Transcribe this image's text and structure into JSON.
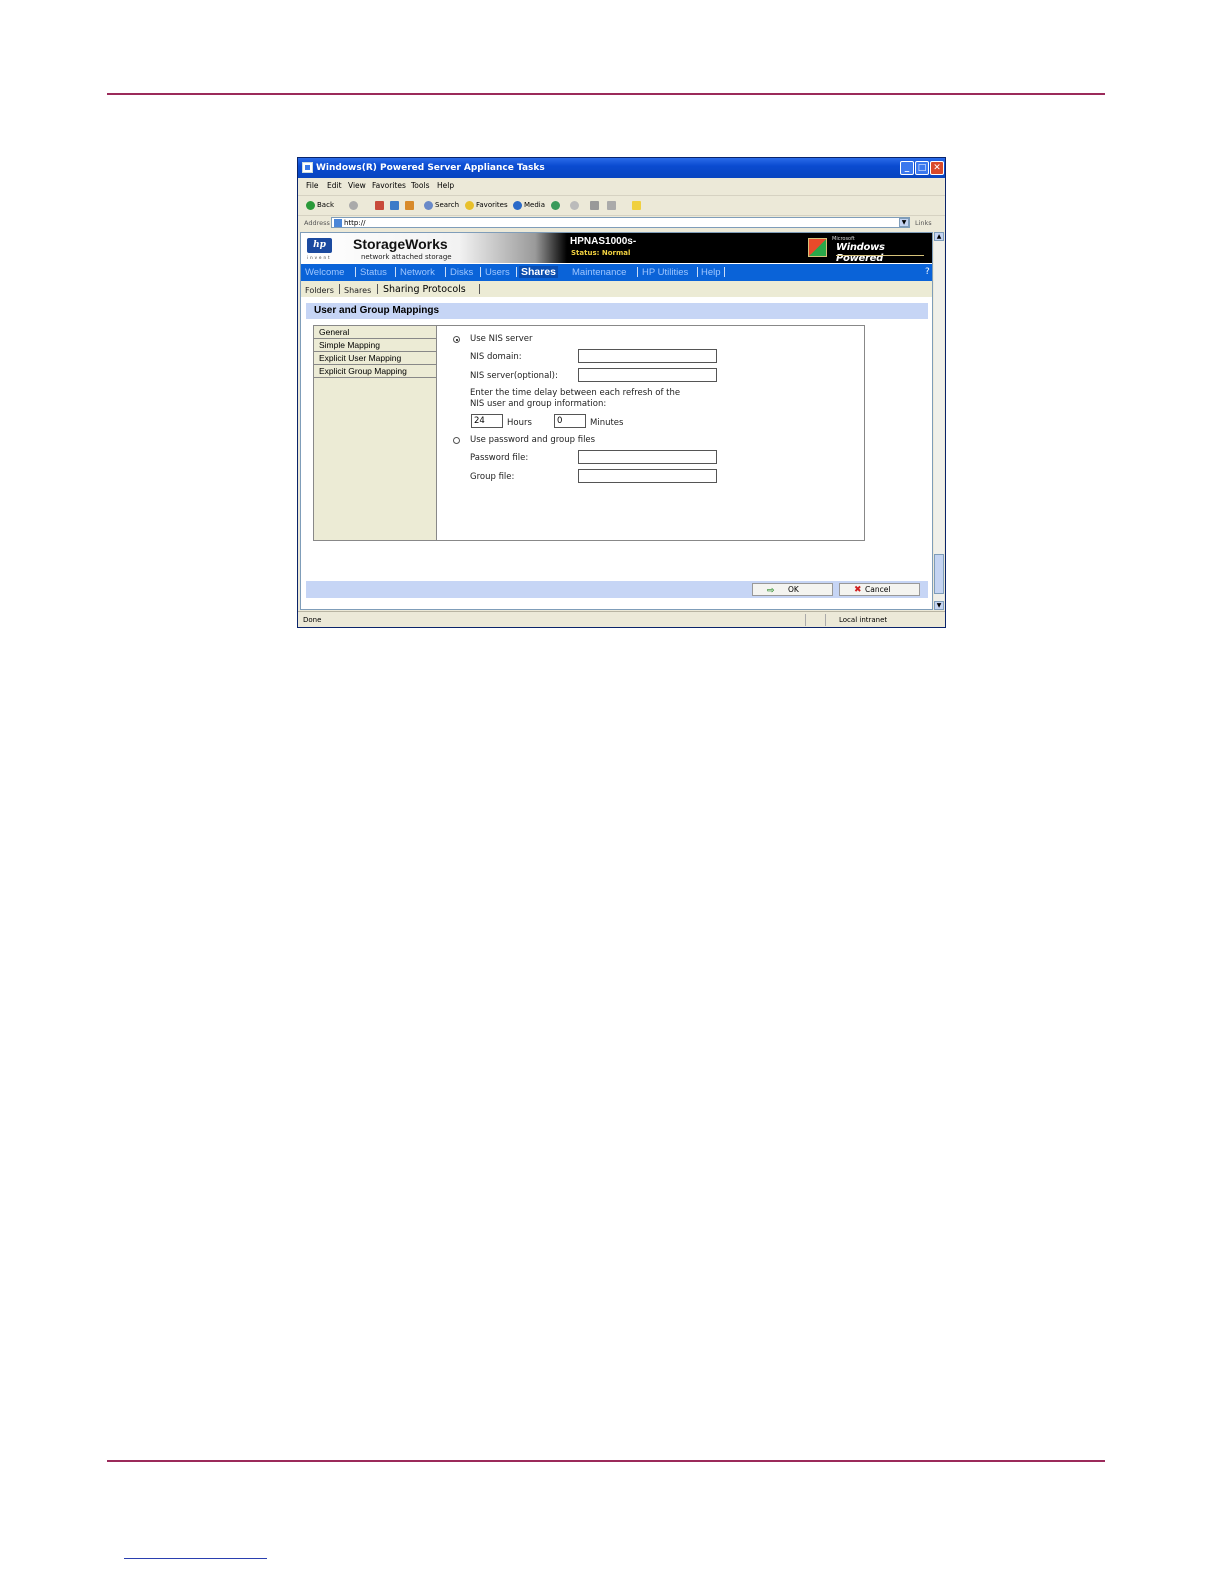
{
  "window": {
    "title": "Windows(R) Powered Server Appliance Tasks",
    "controls": {
      "min": "_",
      "max": "□",
      "close": "✕"
    }
  },
  "menu": [
    "File",
    "Edit",
    "View",
    "Favorites",
    "Tools",
    "Help"
  ],
  "toolbar": {
    "back": "Back",
    "search": "Search",
    "favorites": "Favorites",
    "media": "Media"
  },
  "address": {
    "label": "Address",
    "value": "http://",
    "links": "Links"
  },
  "banner": {
    "logo": "hp",
    "logo_sub": "invent",
    "product": "StorageWorks",
    "product_sub": "network attached storage",
    "server_name": "HPNAS1000s-",
    "status": "Status: Normal",
    "windows_small": "Microsoft",
    "windows_powered": "Windows Powered"
  },
  "nav": {
    "items": [
      "Welcome",
      "Status",
      "Network",
      "Disks",
      "Users",
      "Shares",
      "Maintenance",
      "HP Utilities",
      "Help"
    ],
    "active": "Shares",
    "help_icon": "?"
  },
  "subnav": {
    "items": [
      "Folders",
      "Shares",
      "Sharing Protocols"
    ],
    "active": "Sharing Protocols"
  },
  "page": {
    "title": "User and Group Mappings",
    "tabs": [
      "General",
      "Simple Mapping",
      "Explicit User Mapping",
      "Explicit Group Mapping"
    ],
    "form": {
      "use_nis_label": "Use NIS server",
      "use_nis_selected": true,
      "nis_domain_label": "NIS domain:",
      "nis_domain_value": "",
      "nis_server_label": "NIS server(optional):",
      "nis_server_value": "",
      "delay_text_1": "Enter the time delay between each refresh of the",
      "delay_text_2": "NIS user and group information:",
      "hours_value": "24",
      "hours_label": "Hours",
      "minutes_value": "0",
      "minutes_label": "Minutes",
      "use_files_label": "Use password and group files",
      "use_files_selected": false,
      "password_file_label": "Password file:",
      "password_file_value": "",
      "group_file_label": "Group file:",
      "group_file_value": ""
    },
    "buttons": {
      "ok": "OK",
      "cancel": "Cancel"
    }
  },
  "statusbar": {
    "left": "Done",
    "zone": "Local intranet"
  },
  "colors": {
    "title_bar": "#0a4bd0",
    "nav_bar": "#0a63d8",
    "page_header": "#c6d5f5",
    "document_rule": "#9b2a5a"
  }
}
